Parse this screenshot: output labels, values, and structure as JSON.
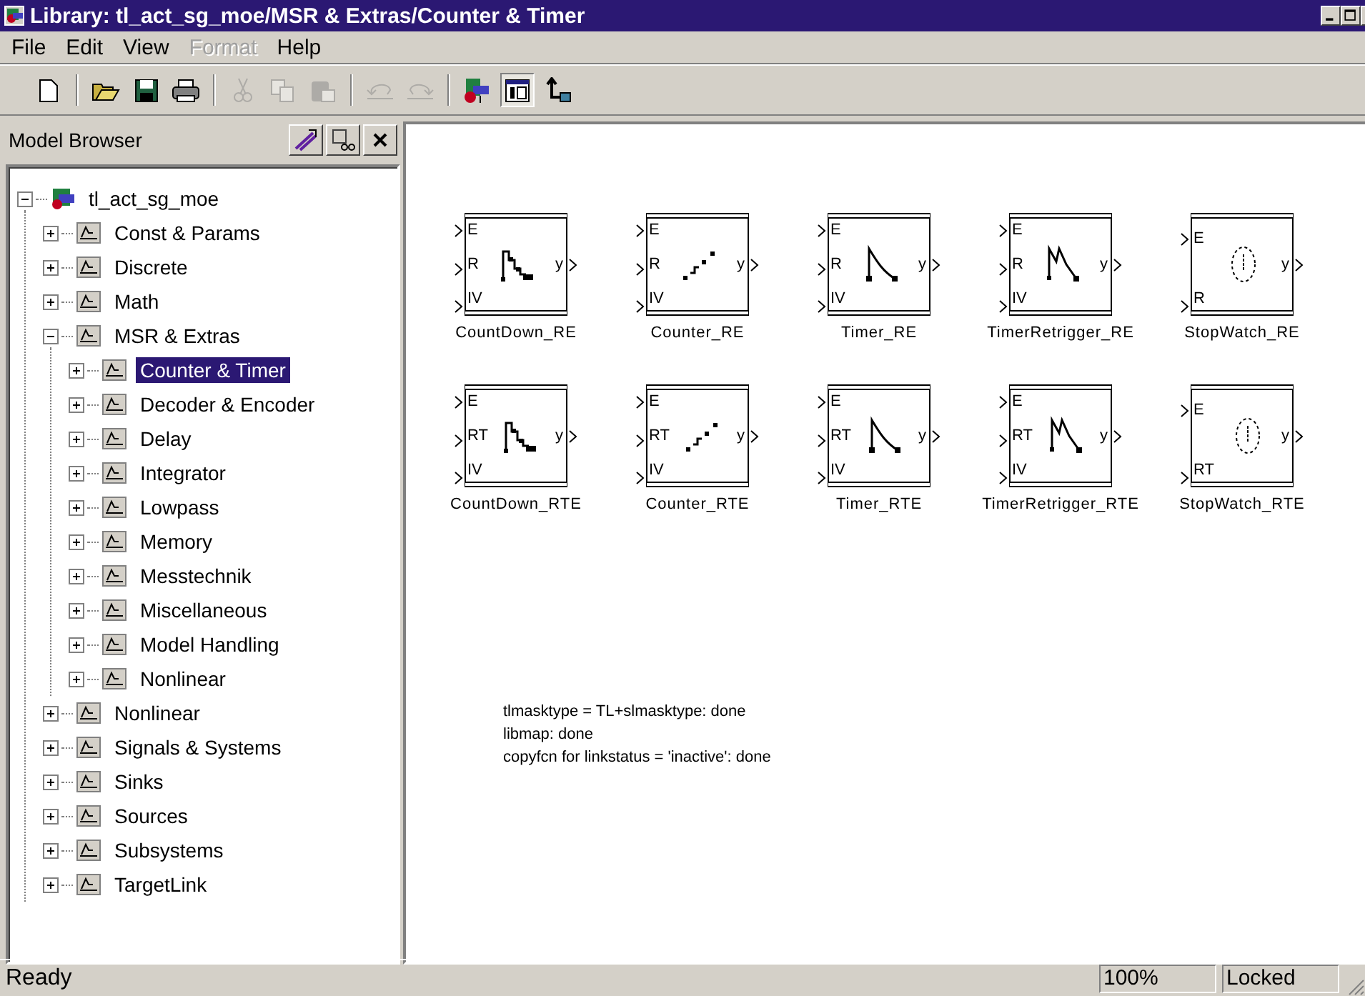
{
  "window": {
    "title": "Library: tl_act_sg_moe/MSR & Extras/Counter & Timer"
  },
  "menu": [
    {
      "label": "File",
      "disabled": false
    },
    {
      "label": "Edit",
      "disabled": false
    },
    {
      "label": "View",
      "disabled": false
    },
    {
      "label": "Format",
      "disabled": true
    },
    {
      "label": "Help",
      "disabled": false
    }
  ],
  "toolbar": [
    {
      "kind": "new",
      "disabled": false,
      "pressed": false
    },
    {
      "kind": "sep"
    },
    {
      "kind": "open",
      "disabled": false,
      "pressed": false
    },
    {
      "kind": "save",
      "disabled": false,
      "pressed": false
    },
    {
      "kind": "print",
      "disabled": false,
      "pressed": false
    },
    {
      "kind": "sep"
    },
    {
      "kind": "cut",
      "disabled": true,
      "pressed": false
    },
    {
      "kind": "copy",
      "disabled": true,
      "pressed": false
    },
    {
      "kind": "paste",
      "disabled": true,
      "pressed": false
    },
    {
      "kind": "sep"
    },
    {
      "kind": "undo",
      "disabled": true,
      "pressed": false
    },
    {
      "kind": "redo",
      "disabled": true,
      "pressed": false
    },
    {
      "kind": "sep"
    },
    {
      "kind": "model",
      "disabled": false,
      "pressed": false
    },
    {
      "kind": "browser",
      "disabled": false,
      "pressed": true
    },
    {
      "kind": "hierarchy",
      "disabled": false,
      "pressed": false
    }
  ],
  "model_browser": {
    "title": "Model Browser",
    "tree": [
      {
        "label": "tl_act_sg_moe",
        "kind": "model",
        "expanded": true,
        "selected": false,
        "children": [
          {
            "label": "Const & Params",
            "kind": "library",
            "expanded": false,
            "selected": false
          },
          {
            "label": "Discrete",
            "kind": "library",
            "expanded": false,
            "selected": false
          },
          {
            "label": "Math",
            "kind": "library",
            "expanded": false,
            "selected": false
          },
          {
            "label": "MSR & Extras",
            "kind": "library",
            "expanded": true,
            "selected": false,
            "children": [
              {
                "label": "Counter & Timer",
                "kind": "library",
                "expanded": false,
                "selected": true
              },
              {
                "label": "Decoder & Encoder",
                "kind": "library",
                "expanded": false,
                "selected": false
              },
              {
                "label": "Delay",
                "kind": "library",
                "expanded": false,
                "selected": false
              },
              {
                "label": "Integrator",
                "kind": "library",
                "expanded": false,
                "selected": false
              },
              {
                "label": "Lowpass",
                "kind": "library",
                "expanded": false,
                "selected": false
              },
              {
                "label": "Memory",
                "kind": "library",
                "expanded": false,
                "selected": false
              },
              {
                "label": "Messtechnik",
                "kind": "library",
                "expanded": false,
                "selected": false
              },
              {
                "label": "Miscellaneous",
                "kind": "library",
                "expanded": false,
                "selected": false
              },
              {
                "label": "Model Handling",
                "kind": "library",
                "expanded": false,
                "selected": false
              },
              {
                "label": "Nonlinear",
                "kind": "library",
                "expanded": false,
                "selected": false
              }
            ]
          },
          {
            "label": "Nonlinear",
            "kind": "library",
            "expanded": false,
            "selected": false
          },
          {
            "label": "Signals & Systems",
            "kind": "library",
            "expanded": false,
            "selected": false
          },
          {
            "label": "Sinks",
            "kind": "library",
            "expanded": false,
            "selected": false
          },
          {
            "label": "Sources",
            "kind": "library",
            "expanded": false,
            "selected": false
          },
          {
            "label": "Subsystems",
            "kind": "library",
            "expanded": false,
            "selected": false
          },
          {
            "label": "TargetLink",
            "kind": "library",
            "expanded": false,
            "selected": false
          }
        ]
      }
    ]
  },
  "canvas": {
    "blocks": [
      {
        "name": "CountDown_RE",
        "kind": "countdown",
        "inputs": [
          "E",
          "R",
          "IV"
        ],
        "output": "y"
      },
      {
        "name": "Counter_RE",
        "kind": "counter",
        "inputs": [
          "E",
          "R",
          "IV"
        ],
        "output": "y"
      },
      {
        "name": "Timer_RE",
        "kind": "timer",
        "inputs": [
          "E",
          "R",
          "IV"
        ],
        "output": "y"
      },
      {
        "name": "TimerRetrigger_RE",
        "kind": "retrigger",
        "inputs": [
          "E",
          "R",
          "IV"
        ],
        "output": "y"
      },
      {
        "name": "StopWatch_RE",
        "kind": "stopwatch",
        "inputs": [
          "E",
          "R"
        ],
        "output": "y"
      },
      {
        "name": "CountDown_RTE",
        "kind": "countdown",
        "inputs": [
          "E",
          "RT",
          "IV"
        ],
        "output": "y"
      },
      {
        "name": "Counter_RTE",
        "kind": "counter",
        "inputs": [
          "E",
          "RT",
          "IV"
        ],
        "output": "y"
      },
      {
        "name": "Timer_RTE",
        "kind": "timer",
        "inputs": [
          "E",
          "RT",
          "IV"
        ],
        "output": "y"
      },
      {
        "name": "TimerRetrigger_RTE",
        "kind": "retrigger",
        "inputs": [
          "E",
          "RT",
          "IV"
        ],
        "output": "y"
      },
      {
        "name": "StopWatch_RTE",
        "kind": "stopwatch",
        "inputs": [
          "E",
          "RT"
        ],
        "output": "y"
      }
    ],
    "messages": [
      "tlmasktype = TL+slmasktype: done",
      "libmap: done",
      "copyfcn for linkstatus = 'inactive': done"
    ]
  },
  "status_bar": {
    "message": "Ready",
    "zoom": "100%",
    "lock": "Locked"
  }
}
